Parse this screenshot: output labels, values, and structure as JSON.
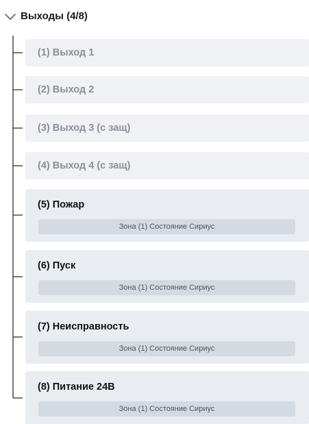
{
  "section": {
    "title": "Выходы (4/8)",
    "expanded": true
  },
  "items": [
    {
      "label": "(1) Выход 1",
      "active": false
    },
    {
      "label": "(2) Выход 2",
      "active": false
    },
    {
      "label": "(3) Выход 3 (с защ)",
      "active": false
    },
    {
      "label": "(4) Выход 4 (с защ)",
      "active": false
    },
    {
      "label": "(5) Пожар",
      "active": true,
      "zone": "Зона (1) Состояние Сириус"
    },
    {
      "label": "(6) Пуск",
      "active": true,
      "zone": "Зона (1) Состояние Сириус"
    },
    {
      "label": "(7) Неисправность",
      "active": true,
      "zone": "Зона (1) Состояние Сириус"
    },
    {
      "label": "(8) Питание 24В",
      "active": true,
      "zone": "Зона (1) Состояние Сириус"
    }
  ],
  "colors": {
    "item_background": "#eff1f4",
    "zone_badge": "#d4dae1",
    "inactive_text": "#8a9099",
    "active_text": "#111111",
    "tree_line": "#4a4a4a"
  }
}
